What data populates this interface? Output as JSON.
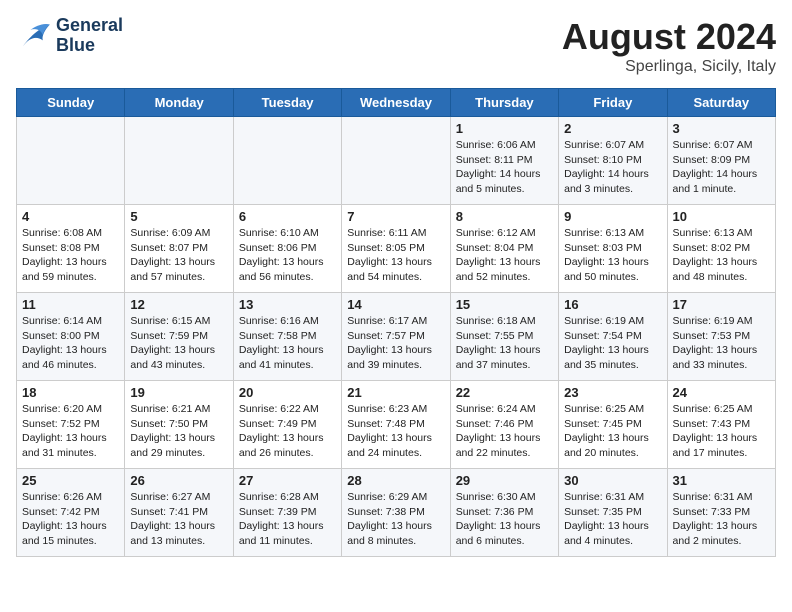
{
  "header": {
    "logo_line1": "General",
    "logo_line2": "Blue",
    "month_year": "August 2024",
    "location": "Sperlinga, Sicily, Italy"
  },
  "weekdays": [
    "Sunday",
    "Monday",
    "Tuesday",
    "Wednesday",
    "Thursday",
    "Friday",
    "Saturday"
  ],
  "weeks": [
    [
      {
        "day": "",
        "info": ""
      },
      {
        "day": "",
        "info": ""
      },
      {
        "day": "",
        "info": ""
      },
      {
        "day": "",
        "info": ""
      },
      {
        "day": "1",
        "info": "Sunrise: 6:06 AM\nSunset: 8:11 PM\nDaylight: 14 hours\nand 5 minutes."
      },
      {
        "day": "2",
        "info": "Sunrise: 6:07 AM\nSunset: 8:10 PM\nDaylight: 14 hours\nand 3 minutes."
      },
      {
        "day": "3",
        "info": "Sunrise: 6:07 AM\nSunset: 8:09 PM\nDaylight: 14 hours\nand 1 minute."
      }
    ],
    [
      {
        "day": "4",
        "info": "Sunrise: 6:08 AM\nSunset: 8:08 PM\nDaylight: 13 hours\nand 59 minutes."
      },
      {
        "day": "5",
        "info": "Sunrise: 6:09 AM\nSunset: 8:07 PM\nDaylight: 13 hours\nand 57 minutes."
      },
      {
        "day": "6",
        "info": "Sunrise: 6:10 AM\nSunset: 8:06 PM\nDaylight: 13 hours\nand 56 minutes."
      },
      {
        "day": "7",
        "info": "Sunrise: 6:11 AM\nSunset: 8:05 PM\nDaylight: 13 hours\nand 54 minutes."
      },
      {
        "day": "8",
        "info": "Sunrise: 6:12 AM\nSunset: 8:04 PM\nDaylight: 13 hours\nand 52 minutes."
      },
      {
        "day": "9",
        "info": "Sunrise: 6:13 AM\nSunset: 8:03 PM\nDaylight: 13 hours\nand 50 minutes."
      },
      {
        "day": "10",
        "info": "Sunrise: 6:13 AM\nSunset: 8:02 PM\nDaylight: 13 hours\nand 48 minutes."
      }
    ],
    [
      {
        "day": "11",
        "info": "Sunrise: 6:14 AM\nSunset: 8:00 PM\nDaylight: 13 hours\nand 46 minutes."
      },
      {
        "day": "12",
        "info": "Sunrise: 6:15 AM\nSunset: 7:59 PM\nDaylight: 13 hours\nand 43 minutes."
      },
      {
        "day": "13",
        "info": "Sunrise: 6:16 AM\nSunset: 7:58 PM\nDaylight: 13 hours\nand 41 minutes."
      },
      {
        "day": "14",
        "info": "Sunrise: 6:17 AM\nSunset: 7:57 PM\nDaylight: 13 hours\nand 39 minutes."
      },
      {
        "day": "15",
        "info": "Sunrise: 6:18 AM\nSunset: 7:55 PM\nDaylight: 13 hours\nand 37 minutes."
      },
      {
        "day": "16",
        "info": "Sunrise: 6:19 AM\nSunset: 7:54 PM\nDaylight: 13 hours\nand 35 minutes."
      },
      {
        "day": "17",
        "info": "Sunrise: 6:19 AM\nSunset: 7:53 PM\nDaylight: 13 hours\nand 33 minutes."
      }
    ],
    [
      {
        "day": "18",
        "info": "Sunrise: 6:20 AM\nSunset: 7:52 PM\nDaylight: 13 hours\nand 31 minutes."
      },
      {
        "day": "19",
        "info": "Sunrise: 6:21 AM\nSunset: 7:50 PM\nDaylight: 13 hours\nand 29 minutes."
      },
      {
        "day": "20",
        "info": "Sunrise: 6:22 AM\nSunset: 7:49 PM\nDaylight: 13 hours\nand 26 minutes."
      },
      {
        "day": "21",
        "info": "Sunrise: 6:23 AM\nSunset: 7:48 PM\nDaylight: 13 hours\nand 24 minutes."
      },
      {
        "day": "22",
        "info": "Sunrise: 6:24 AM\nSunset: 7:46 PM\nDaylight: 13 hours\nand 22 minutes."
      },
      {
        "day": "23",
        "info": "Sunrise: 6:25 AM\nSunset: 7:45 PM\nDaylight: 13 hours\nand 20 minutes."
      },
      {
        "day": "24",
        "info": "Sunrise: 6:25 AM\nSunset: 7:43 PM\nDaylight: 13 hours\nand 17 minutes."
      }
    ],
    [
      {
        "day": "25",
        "info": "Sunrise: 6:26 AM\nSunset: 7:42 PM\nDaylight: 13 hours\nand 15 minutes."
      },
      {
        "day": "26",
        "info": "Sunrise: 6:27 AM\nSunset: 7:41 PM\nDaylight: 13 hours\nand 13 minutes."
      },
      {
        "day": "27",
        "info": "Sunrise: 6:28 AM\nSunset: 7:39 PM\nDaylight: 13 hours\nand 11 minutes."
      },
      {
        "day": "28",
        "info": "Sunrise: 6:29 AM\nSunset: 7:38 PM\nDaylight: 13 hours\nand 8 minutes."
      },
      {
        "day": "29",
        "info": "Sunrise: 6:30 AM\nSunset: 7:36 PM\nDaylight: 13 hours\nand 6 minutes."
      },
      {
        "day": "30",
        "info": "Sunrise: 6:31 AM\nSunset: 7:35 PM\nDaylight: 13 hours\nand 4 minutes."
      },
      {
        "day": "31",
        "info": "Sunrise: 6:31 AM\nSunset: 7:33 PM\nDaylight: 13 hours\nand 2 minutes."
      }
    ]
  ]
}
